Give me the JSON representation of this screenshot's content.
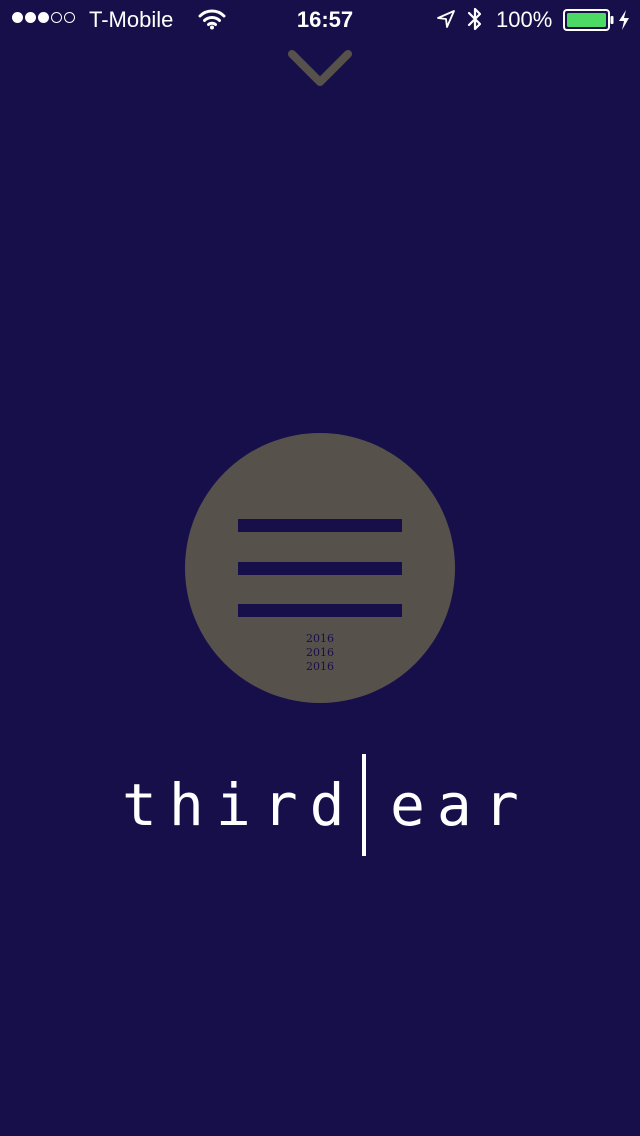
{
  "status_bar": {
    "signal": {
      "filled": 3,
      "total": 5
    },
    "carrier": "T-Mobile",
    "time": "16:57",
    "battery_percent": "100%",
    "battery_level": 1.0,
    "battery_color": "#4cd964",
    "icons": [
      "wifi-icon",
      "location-arrow-icon",
      "bluetooth-icon",
      "battery-icon",
      "charging-bolt-icon"
    ]
  },
  "header": {
    "collapse_icon": "chevron-down-icon",
    "collapse_color": "#57514c"
  },
  "logo": {
    "circle_color": "#57514c",
    "bar_count": 3,
    "years": [
      "2016",
      "2016",
      "2016"
    ]
  },
  "wordmark": {
    "left": "third",
    "right": "ear"
  },
  "colors": {
    "background": "#170f49",
    "text": "#ffffff"
  }
}
